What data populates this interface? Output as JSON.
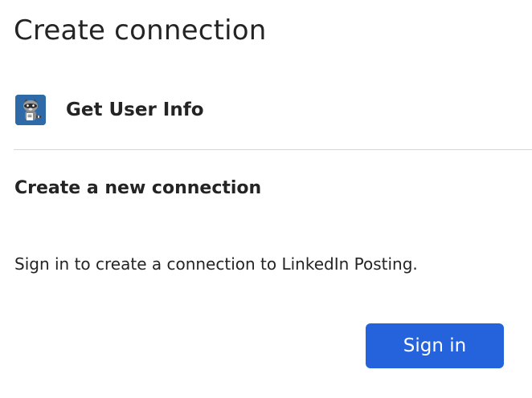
{
  "dialog": {
    "title": "Create connection"
  },
  "action": {
    "label": "Get User Info",
    "icon": "raccoon-logo-icon",
    "icon_bg": "#2f6aa8"
  },
  "section": {
    "heading": "Create a new connection",
    "message": "Sign in to create a connection to LinkedIn Posting."
  },
  "button": {
    "label": "Sign in",
    "color": "#2563dd"
  }
}
